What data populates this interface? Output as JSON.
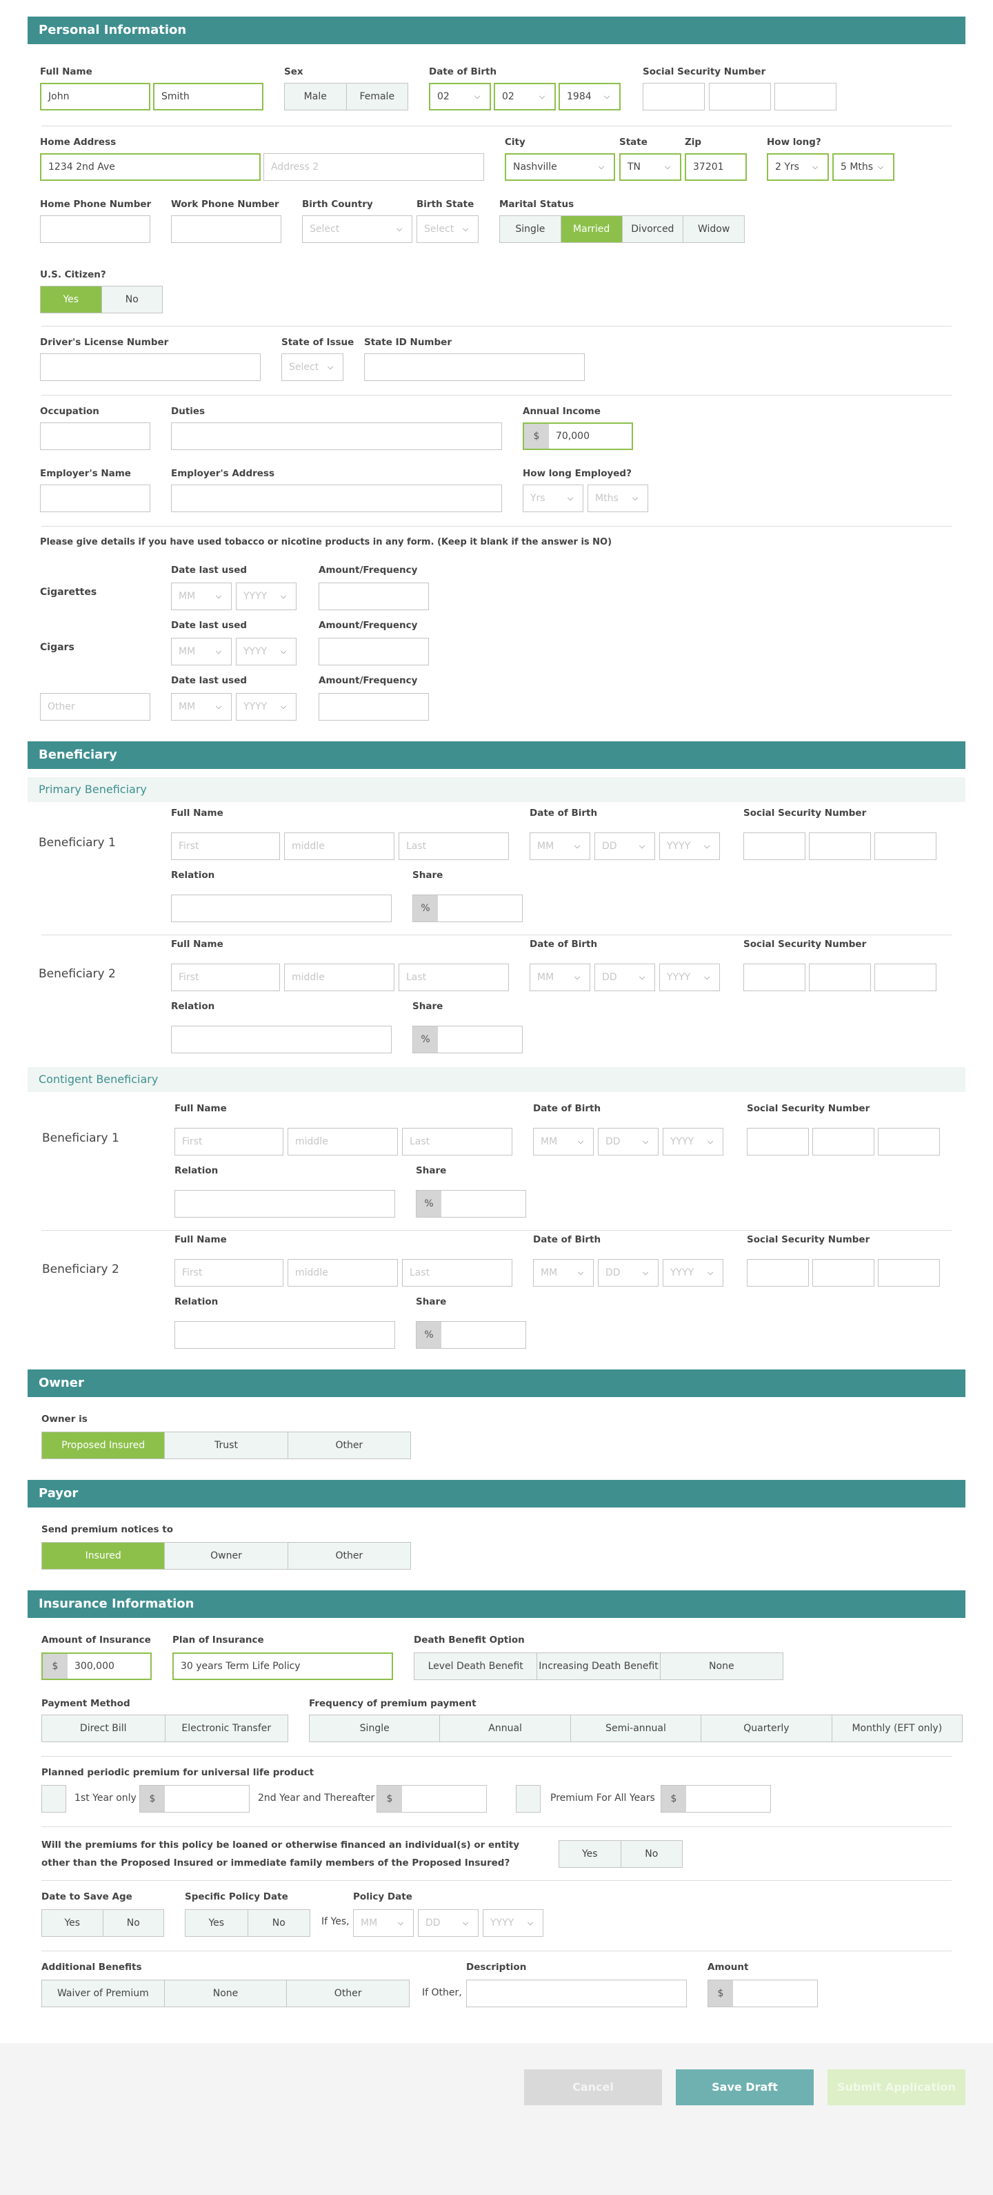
{
  "common": {
    "full_name": "Full Name",
    "date_of_birth": "Date of Birth",
    "ssn": "Social Security Number",
    "relation": "Relation",
    "share": "Share",
    "date_last_used": "Date last used",
    "amount_frequency": "Amount/Frequency",
    "ph_first": "First",
    "ph_middle": "middle",
    "ph_last": "Last",
    "ph_mm": "MM",
    "ph_dd": "DD",
    "ph_yyyy": "YYYY",
    "ph_select": "Select",
    "ph_yrs": "Yrs",
    "ph_mths": "Mths",
    "ph_other": "Other",
    "ph_address2": "Address 2",
    "pct": "%",
    "dollar": "$",
    "chevron": "chevron-down-icon"
  },
  "personal": {
    "title": "Personal Information",
    "first_name": "John",
    "last_name": "Smith",
    "sex_label": "Sex",
    "sex_options": [
      "Male",
      "Female"
    ],
    "dob": {
      "month": "02",
      "day": "02",
      "year": "1984"
    },
    "home_address_label": "Home Address",
    "home_address": "1234 2nd Ave",
    "city_label": "City",
    "city": "Nashville",
    "state_label": "State",
    "state": "TN",
    "zip_label": "Zip",
    "zip": "37201",
    "how_long_label": "How long?",
    "how_long_years": "2 Yrs",
    "how_long_months": "5 Mths",
    "home_phone_label": "Home Phone Number",
    "work_phone_label": "Work Phone Number",
    "birth_country_label": "Birth Country",
    "birth_state_label": "Birth State",
    "marital_label": "Marital Status",
    "marital_options": [
      "Single",
      "Married",
      "Divorced",
      "Widow"
    ],
    "marital_selected": "Married",
    "citizen_label": "U.S. Citizen?",
    "citizen_options": [
      "Yes",
      "No"
    ],
    "citizen_selected": "Yes",
    "license_label": "Driver's License Number",
    "state_of_issue_label": "State of Issue",
    "state_id_label": "State ID Number",
    "occupation_label": "Occupation",
    "duties_label": "Duties",
    "annual_income_label": "Annual Income",
    "annual_income": "70,000",
    "employer_name_label": "Employer's Name",
    "employer_address_label": "Employer's Address",
    "how_long_employed_label": "How long Employed?",
    "tobacco_text": "Please give details if you have used tobacco or nicotine products in any form. (Keep it blank if the answer is NO)",
    "cigarettes_label": "Cigarettes",
    "cigars_label": "Cigars"
  },
  "beneficiary": {
    "title": "Beneficiary",
    "primary_title": "Primary Beneficiary",
    "contingent_title": "Contigent Beneficiary",
    "b1_label": "Beneficiary 1",
    "b2_label": "Beneficiary 2"
  },
  "owner": {
    "title": "Owner",
    "owner_is_label": "Owner is",
    "options": [
      "Proposed Insured",
      "Trust",
      "Other"
    ],
    "selected": "Proposed Insured"
  },
  "payor": {
    "title": "Payor",
    "send_label": "Send premium notices to",
    "options": [
      "Insured",
      "Owner",
      "Other"
    ],
    "selected": "Insured"
  },
  "insurance": {
    "title": "Insurance Information",
    "amount_label": "Amount of Insurance",
    "amount": "300,000",
    "plan_label": "Plan of Insurance",
    "plan": "30 years Term Life Policy",
    "death_benefit_label": "Death Benefit Option",
    "death_benefit_options": [
      "Level Death Benefit",
      "Increasing Death Benefit",
      "None"
    ],
    "payment_method_label": "Payment Method",
    "payment_method_options": [
      "Direct Bill",
      "Electronic Transfer"
    ],
    "frequency_label": "Frequency of premium payment",
    "frequency_options": [
      "Single",
      "Annual",
      "Semi-annual",
      "Quarterly",
      "Monthly (EFT only)"
    ],
    "planned_label": "Planned periodic premium for universal life product",
    "first_year_label": "1st Year only",
    "second_year_label": "2nd Year and Thereafter",
    "all_years_label": "Premium For All Years",
    "loan_question": "Will the premiums for this policy be loaned or otherwise financed an individual(s) or entity other than the Proposed Insured or immediate family members of the Proposed Insured?",
    "loan_options": [
      "Yes",
      "No"
    ],
    "save_age_label": "Date to Save Age",
    "save_age_options": [
      "Yes",
      "No"
    ],
    "specific_date_label": "Specific Policy Date",
    "specific_date_options": [
      "Yes",
      "No"
    ],
    "if_yes": "If Yes,",
    "policy_date_label": "Policy Date",
    "additional_label": "Additional Benefits",
    "additional_options": [
      "Waiver of Premium",
      "None",
      "Other"
    ],
    "if_other": "If Other,",
    "description_label": "Description",
    "amount2_label": "Amount"
  },
  "actions": {
    "cancel": "Cancel",
    "save_draft": "Save Draft",
    "submit": "Submit Application"
  },
  "colors": {
    "header": "#3f8f8f",
    "selected": "#8dc04b",
    "segment_bg": "#eef5f3",
    "save_draft": "#6fb1b1",
    "submit_disabled": "#dcefc6",
    "cancel_disabled": "#d9d9d9"
  }
}
